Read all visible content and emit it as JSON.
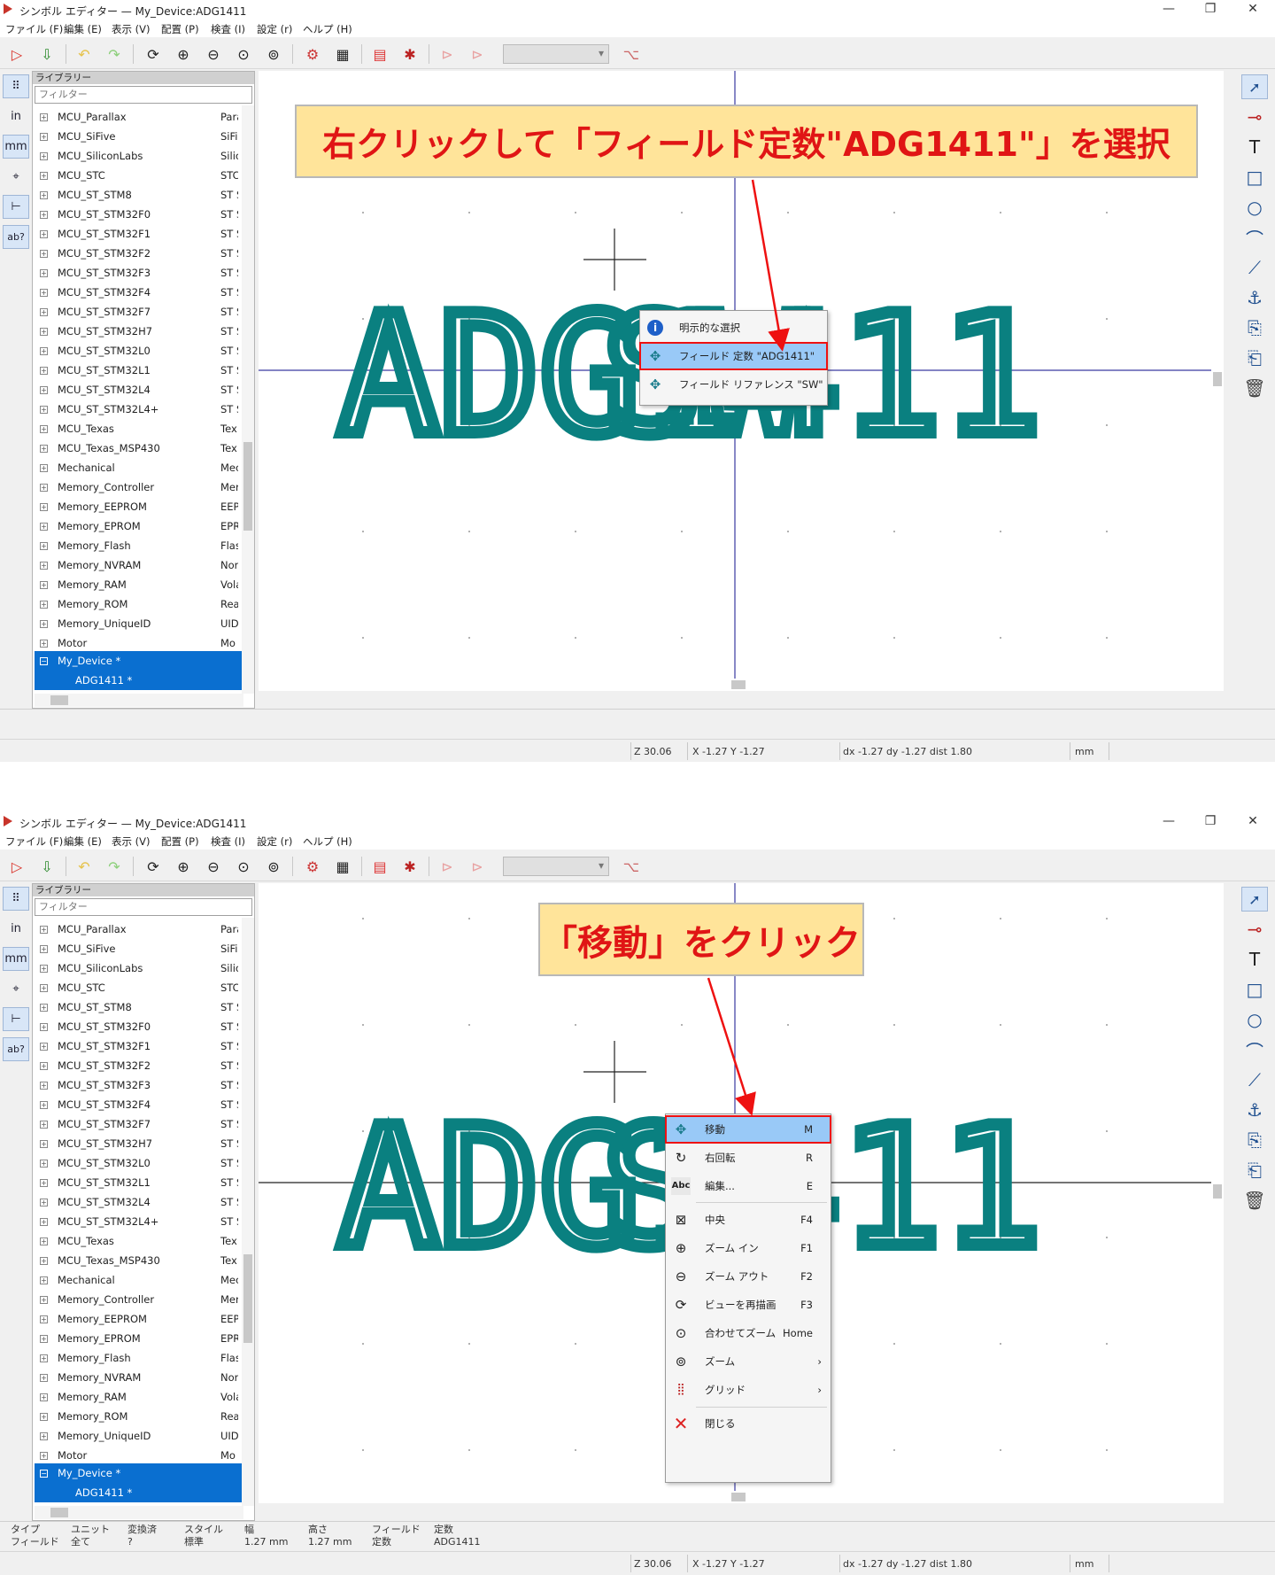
{
  "common": {
    "window_title": "シンボル エディター — My_Device:ADG1411",
    "min_icon": "—",
    "restore_icon": "❐",
    "close_icon": "✕",
    "menu": [
      "ファイル (F)",
      "編集 (E)",
      "表示 (V)",
      "配置 (P)",
      "検査 (I)",
      "設定 (r)",
      "ヘルプ (H)"
    ],
    "library_header": "ライブラリー",
    "filter_placeholder": "フィルター",
    "units_in": "in",
    "units_mm": "mm",
    "left_tool_ab": "ab?",
    "libraries": [
      {
        "name": "MCU_Parallax",
        "desc": "Para"
      },
      {
        "name": "MCU_SiFive",
        "desc": "SiFi"
      },
      {
        "name": "MCU_SiliconLabs",
        "desc": "Silic"
      },
      {
        "name": "MCU_STC",
        "desc": "STC"
      },
      {
        "name": "MCU_ST_STM8",
        "desc": "ST S"
      },
      {
        "name": "MCU_ST_STM32F0",
        "desc": "ST S"
      },
      {
        "name": "MCU_ST_STM32F1",
        "desc": "ST S"
      },
      {
        "name": "MCU_ST_STM32F2",
        "desc": "ST S"
      },
      {
        "name": "MCU_ST_STM32F3",
        "desc": "ST S"
      },
      {
        "name": "MCU_ST_STM32F4",
        "desc": "ST S"
      },
      {
        "name": "MCU_ST_STM32F7",
        "desc": "ST S"
      },
      {
        "name": "MCU_ST_STM32H7",
        "desc": "ST S"
      },
      {
        "name": "MCU_ST_STM32L0",
        "desc": "ST S"
      },
      {
        "name": "MCU_ST_STM32L1",
        "desc": "ST S"
      },
      {
        "name": "MCU_ST_STM32L4",
        "desc": "ST S"
      },
      {
        "name": "MCU_ST_STM32L4+",
        "desc": "ST S"
      },
      {
        "name": "MCU_Texas",
        "desc": "Tex"
      },
      {
        "name": "MCU_Texas_MSP430",
        "desc": "Tex"
      },
      {
        "name": "Mechanical",
        "desc": "Mec"
      },
      {
        "name": "Memory_Controller",
        "desc": "Mer"
      },
      {
        "name": "Memory_EEPROM",
        "desc": "EEP"
      },
      {
        "name": "Memory_EPROM",
        "desc": "EPR"
      },
      {
        "name": "Memory_Flash",
        "desc": "Flas"
      },
      {
        "name": "Memory_NVRAM",
        "desc": "Nor"
      },
      {
        "name": "Memory_RAM",
        "desc": "Vola"
      },
      {
        "name": "Memory_ROM",
        "desc": "Rea"
      },
      {
        "name": "Memory_UniqueID",
        "desc": "UID"
      },
      {
        "name": "Motor",
        "desc": "Mo"
      }
    ],
    "selected_library": "My_Device *",
    "selected_symbol": "ADG1411 *",
    "canvas_value_text": "ADG1411",
    "canvas_ref_text": "SW",
    "status": {
      "zoom": "Z 30.06",
      "xy": "X -1.27  Y -1.27",
      "dxy": "dx -1.27  dy -1.27  dist 1.80",
      "units": "mm"
    },
    "accent": "#0a6fd0",
    "symbol_color": "#0a8080",
    "callout_text_color": "#e01515"
  },
  "shot1": {
    "callout": "右クリックして「フィールド定数\"ADG1411\"」を選択",
    "menu_items": [
      {
        "icon": "info-icon",
        "label": "明示的な選択"
      },
      {
        "icon": "move-icon",
        "label": "フィールド 定数 \"ADG1411\""
      },
      {
        "icon": "move-icon",
        "label": "フィールド リファレンス \"SW\""
      }
    ]
  },
  "shot2": {
    "callout": "「移動」をクリック",
    "menu_items": [
      {
        "icon": "move-icon",
        "label": "移動",
        "shortcut": "M"
      },
      {
        "icon": "rotate-icon",
        "label": "右回転",
        "shortcut": "R"
      },
      {
        "icon": "abc-icon",
        "label": "編集...",
        "shortcut": "E"
      },
      {
        "icon": "center-icon",
        "label": "中央",
        "shortcut": "F4"
      },
      {
        "icon": "zoom-in-icon",
        "label": "ズーム イン",
        "shortcut": "F1"
      },
      {
        "icon": "zoom-out-icon",
        "label": "ズーム アウト",
        "shortcut": "F2"
      },
      {
        "icon": "redraw-icon",
        "label": "ビューを再描画",
        "shortcut": "F3"
      },
      {
        "icon": "zoom-fit-icon",
        "label": "合わせてズーム",
        "shortcut": "Home"
      },
      {
        "icon": "zoom-icon",
        "label": "ズーム",
        "shortcut": "›"
      },
      {
        "icon": "grid-icon",
        "label": "グリッド",
        "shortcut": "›"
      },
      {
        "icon": "close-x-icon",
        "label": "閉じる",
        "shortcut": ""
      }
    ],
    "abc_icon_text": "Abc",
    "info": [
      {
        "label": "タイプ",
        "value": "フィールド"
      },
      {
        "label": "ユニット",
        "value": "全て"
      },
      {
        "label": "変換済",
        "value": "?"
      },
      {
        "label": "スタイル",
        "value": "標準"
      },
      {
        "label": "幅",
        "value": "1.27 mm"
      },
      {
        "label": "高さ",
        "value": "1.27 mm"
      },
      {
        "label": "フィールド",
        "value": "定数"
      },
      {
        "label": "定数",
        "value": "ADG1411"
      }
    ]
  }
}
